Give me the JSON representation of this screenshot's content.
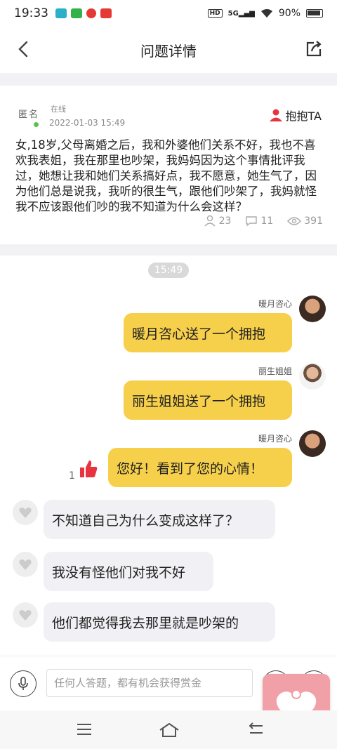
{
  "status": {
    "time": "19:33",
    "hd": "HD",
    "network": "5G",
    "battery": "90%"
  },
  "nav": {
    "title": "问题详情"
  },
  "question": {
    "anon_label": "匿名",
    "online_label": "在线",
    "date": "2022-01-03 15:49",
    "hug_label": "抱抱TA",
    "text": "女,18岁,父母离婚之后，我和外婆他们关系不好，我也不喜欢我表姐，我在那里也吵架，我妈妈因为这个事情批评我过，她想让我和她们关系搞好点，我不愿意，她生气了，因为他们总是说我，我听的很生气，跟他们吵架了，我妈就怪我不应该跟他们吵的我不知道为什么会这样？",
    "stats": {
      "hugs": "23",
      "comments": "11",
      "views": "391"
    }
  },
  "chat": {
    "time_divider": "15:49",
    "messages": [
      {
        "sender": "暖月咨心",
        "text": "暖月咨心送了一个拥抱"
      },
      {
        "sender": "丽生姐姐",
        "text": "丽生姐姐送了一个拥抱"
      },
      {
        "sender": "暖月咨心",
        "text": "您好！看到了您的心情！",
        "likes": "1"
      },
      {
        "text": "不知道自己为什么变成这样了？"
      },
      {
        "text": "我没有怪他们对我不好"
      },
      {
        "text": "他们都觉得我去那里就是吵架的"
      }
    ]
  },
  "input": {
    "placeholder": "任何人答题，都有机会获得赏金"
  },
  "colors": {
    "bubble_yellow": "#f7d04b",
    "bubble_gray": "#f1f1f5",
    "accent_red": "#e8333f",
    "float_pink": "#f0a0a6",
    "online_green": "#5ac24f"
  }
}
